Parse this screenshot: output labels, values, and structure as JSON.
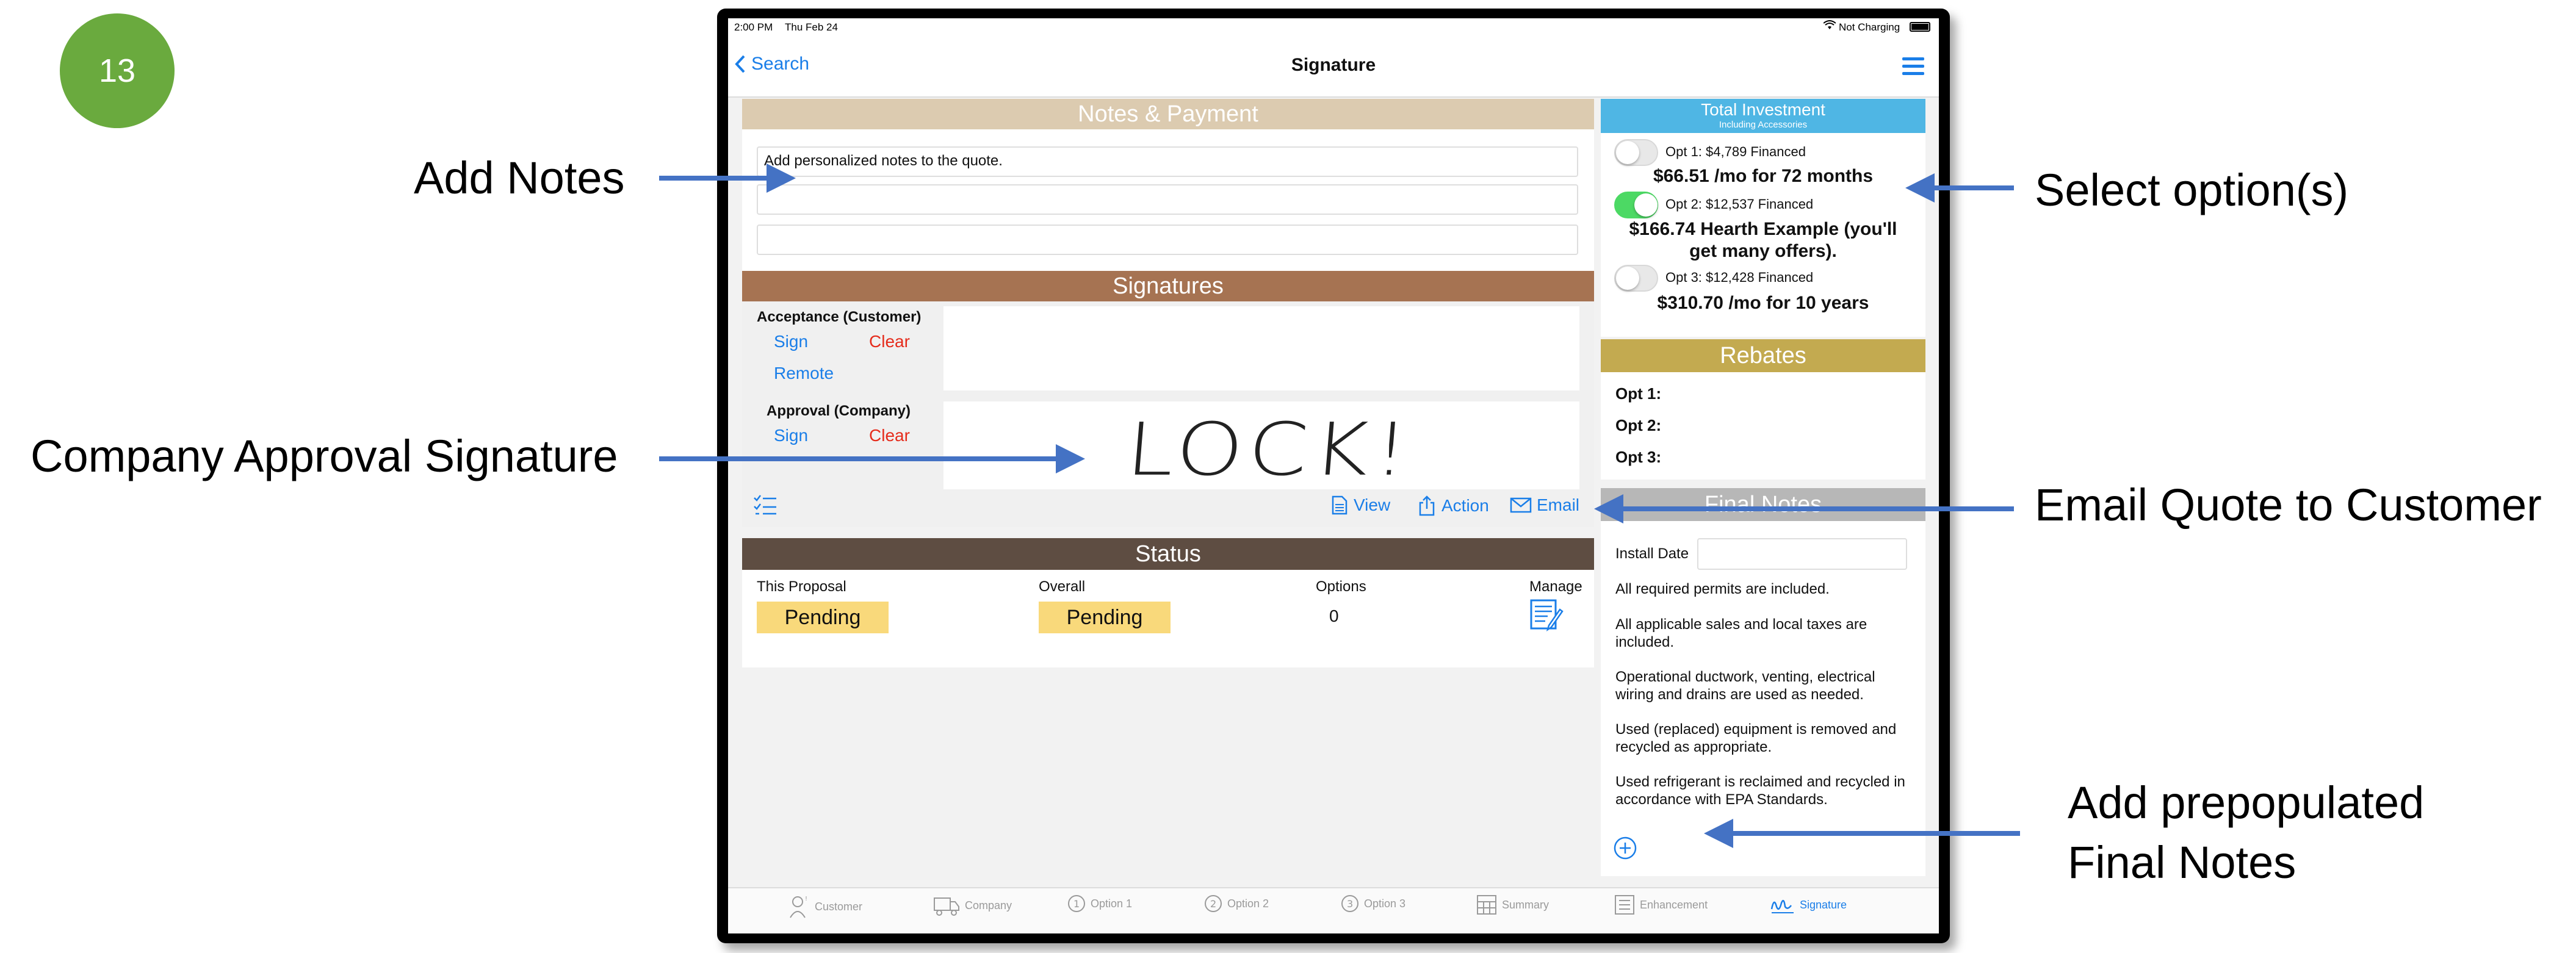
{
  "badge": "13",
  "callouts": {
    "add_notes": "Add Notes",
    "company_signature": "Company Approval Signature",
    "select_option": "Select option(s)",
    "email_quote": "Email Quote to Customer",
    "final_notes_line1": "Add prepopulated",
    "final_notes_line2": "Final Notes"
  },
  "status_bar": {
    "time": "2:00 PM",
    "date": "Thu Feb 24",
    "battery": "Not Charging"
  },
  "nav": {
    "back": "Search",
    "title": "Signature"
  },
  "notes_payment": {
    "header": "Notes & Payment",
    "placeholder": "Add personalized notes to the quote."
  },
  "signatures": {
    "header": "Signatures",
    "acceptance_label": "Acceptance (Customer)",
    "approval_label": "Approval (Company)",
    "sign": "Sign",
    "clear": "Clear",
    "remote": "Remote",
    "view": "View",
    "action": "Action",
    "email": "Email",
    "approval_signature_text": "LOCK!"
  },
  "status": {
    "header": "Status",
    "this_proposal": "This Proposal",
    "overall": "Overall",
    "options": "Options",
    "manage": "Manage",
    "this_proposal_value": "Pending",
    "overall_value": "Pending",
    "options_value": "0"
  },
  "investment": {
    "header": "Total Investment",
    "subheader": "Including Accessories",
    "options": [
      {
        "label": "Opt 1: $4,789 Financed",
        "detail": "$66.51  /mo for 72 months",
        "on": false
      },
      {
        "label": "Opt 2: $12,537 Financed",
        "detail": "$166.74 Hearth Example (you'll get many offers).",
        "on": true
      },
      {
        "label": "Opt 3: $12,428 Financed",
        "detail": "$310.70  /mo for 10 years",
        "on": false
      }
    ]
  },
  "rebates": {
    "header": "Rebates",
    "items": [
      "Opt 1:",
      "Opt 2:",
      "Opt 3:"
    ]
  },
  "final_notes": {
    "header": "Final Notes",
    "install_date_label": "Install Date",
    "notes": [
      "All required permits are included.",
      "All applicable sales and local taxes are included.",
      "Operational ductwork, venting, electrical wiring and drains are used as needed.",
      "Used (replaced) equipment is removed and recycled as appropriate.",
      "Used refrigerant is reclaimed and recycled in accordance with EPA Standards."
    ]
  },
  "tabs": [
    "Customer",
    "Company",
    "Option 1",
    "Option 2",
    "Option 3",
    "Summary",
    "Enhancement",
    "Signature"
  ],
  "colors": {
    "notes_header": "#dccbb0",
    "signatures_header": "#a67352",
    "status_header": "#5e4d42",
    "investment_header": "#4fb6e4",
    "rebates_header": "#c3aa50",
    "final_notes_header": "#b7b7b7",
    "accent": "#1a7ee8",
    "arrow": "#4472c4"
  }
}
